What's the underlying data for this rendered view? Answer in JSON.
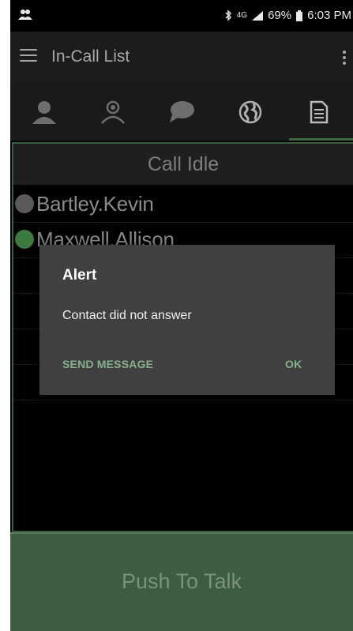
{
  "status_bar": {
    "network": "4G",
    "battery": "69%",
    "time": "6:03 PM"
  },
  "app_bar": {
    "title": "In-Call List"
  },
  "tabs": [
    {
      "icon": "person-icon",
      "active": false
    },
    {
      "icon": "group-icon",
      "active": false
    },
    {
      "icon": "chat-bubble-icon",
      "active": false
    },
    {
      "icon": "globe-icon",
      "active": false
    },
    {
      "icon": "document-icon",
      "active": true
    }
  ],
  "call_status": "Call Idle",
  "contacts": [
    {
      "name": "Bartley.Kevin",
      "dot_color": "#5a5a5a"
    },
    {
      "name": "Maxwell.Allison",
      "dot_color": "#3c7a40"
    }
  ],
  "dialog": {
    "title": "Alert",
    "message": "Contact did not answer",
    "negative_button": "SEND MESSAGE",
    "positive_button": "OK"
  },
  "push_to_talk": "Push To Talk",
  "colors": {
    "accent_green": "#3c6a42",
    "dialog_bg": "#404040",
    "dialog_button_text": "#88b08c"
  }
}
